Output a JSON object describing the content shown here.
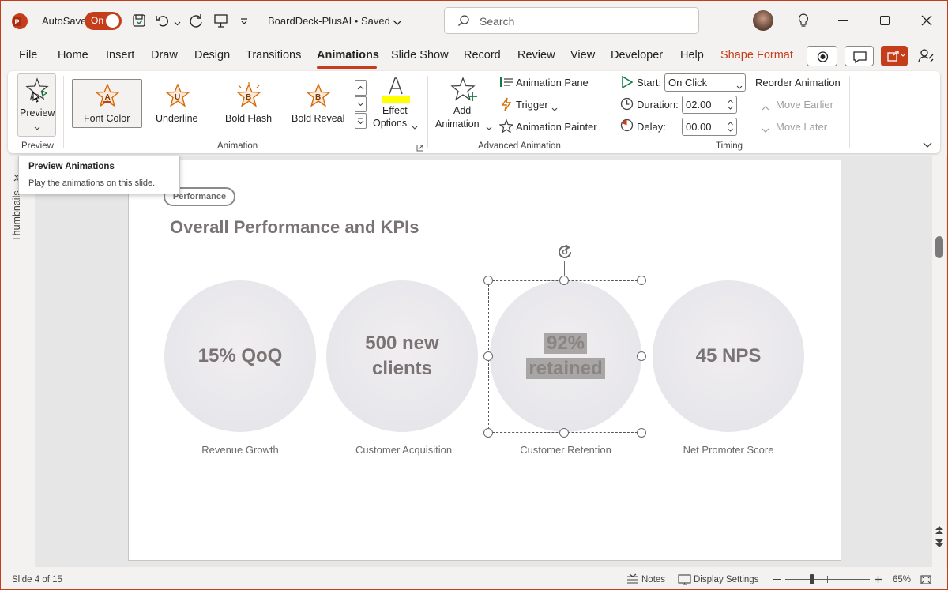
{
  "app": {
    "autosave_label": "AutoSave",
    "autosave_state": "On",
    "doc_title": "BoardDeck-PlusAI • Saved",
    "search_placeholder": "Search"
  },
  "menu": [
    {
      "label": "File"
    },
    {
      "label": "Home"
    },
    {
      "label": "Insert"
    },
    {
      "label": "Draw"
    },
    {
      "label": "Design"
    },
    {
      "label": "Transitions"
    },
    {
      "label": "Animations"
    },
    {
      "label": "Slide Show"
    },
    {
      "label": "Record"
    },
    {
      "label": "Review"
    },
    {
      "label": "View"
    },
    {
      "label": "Developer"
    },
    {
      "label": "Help"
    },
    {
      "label": "Shape Format"
    }
  ],
  "ribbon": {
    "preview": {
      "label": "Preview",
      "group": "Preview"
    },
    "animations": [
      {
        "label": "Font Color",
        "letter": "A"
      },
      {
        "label": "Underline",
        "letter": "U"
      },
      {
        "label": "Bold Flash",
        "letter": "B"
      },
      {
        "label": "Bold Reveal",
        "letter": "B"
      }
    ],
    "effect_options": {
      "line1": "Effect",
      "line2": "Options"
    },
    "animation_group": "Animation",
    "advanced": {
      "add_line1": "Add",
      "add_line2": "Animation",
      "pane": "Animation Pane",
      "trigger": "Trigger",
      "painter": "Animation Painter",
      "group": "Advanced Animation"
    },
    "timing": {
      "start_label": "Start:",
      "start_value": "On Click",
      "duration_label": "Duration:",
      "duration_value": "02.00",
      "delay_label": "Delay:",
      "delay_value": "00.00",
      "group": "Timing",
      "reorder": "Reorder Animation",
      "move_earlier": "Move Earlier",
      "move_later": "Move Later"
    }
  },
  "tooltip": {
    "title": "Preview Animations",
    "body": "Play the animations on this slide."
  },
  "thumbnails_label": "Thumbnails",
  "slide": {
    "tag": "Performance",
    "title": "Overall Performance and KPIs",
    "kpis": [
      {
        "line1": "15% QoQ",
        "line2": "",
        "caption": "Revenue Growth"
      },
      {
        "line1": "500 new",
        "line2": "clients",
        "caption": "Customer Acquisition"
      },
      {
        "line1": "92%",
        "line2": "retained",
        "caption": "Customer Retention"
      },
      {
        "line1": "45 NPS",
        "line2": "",
        "caption": "Net Promoter Score"
      }
    ]
  },
  "status": {
    "slide_info": "Slide 4 of 15",
    "notes": "Notes",
    "display_settings": "Display Settings",
    "zoom": "65%"
  },
  "colors": {
    "accent": "#c43e1c",
    "highlight": "#ffff00"
  }
}
